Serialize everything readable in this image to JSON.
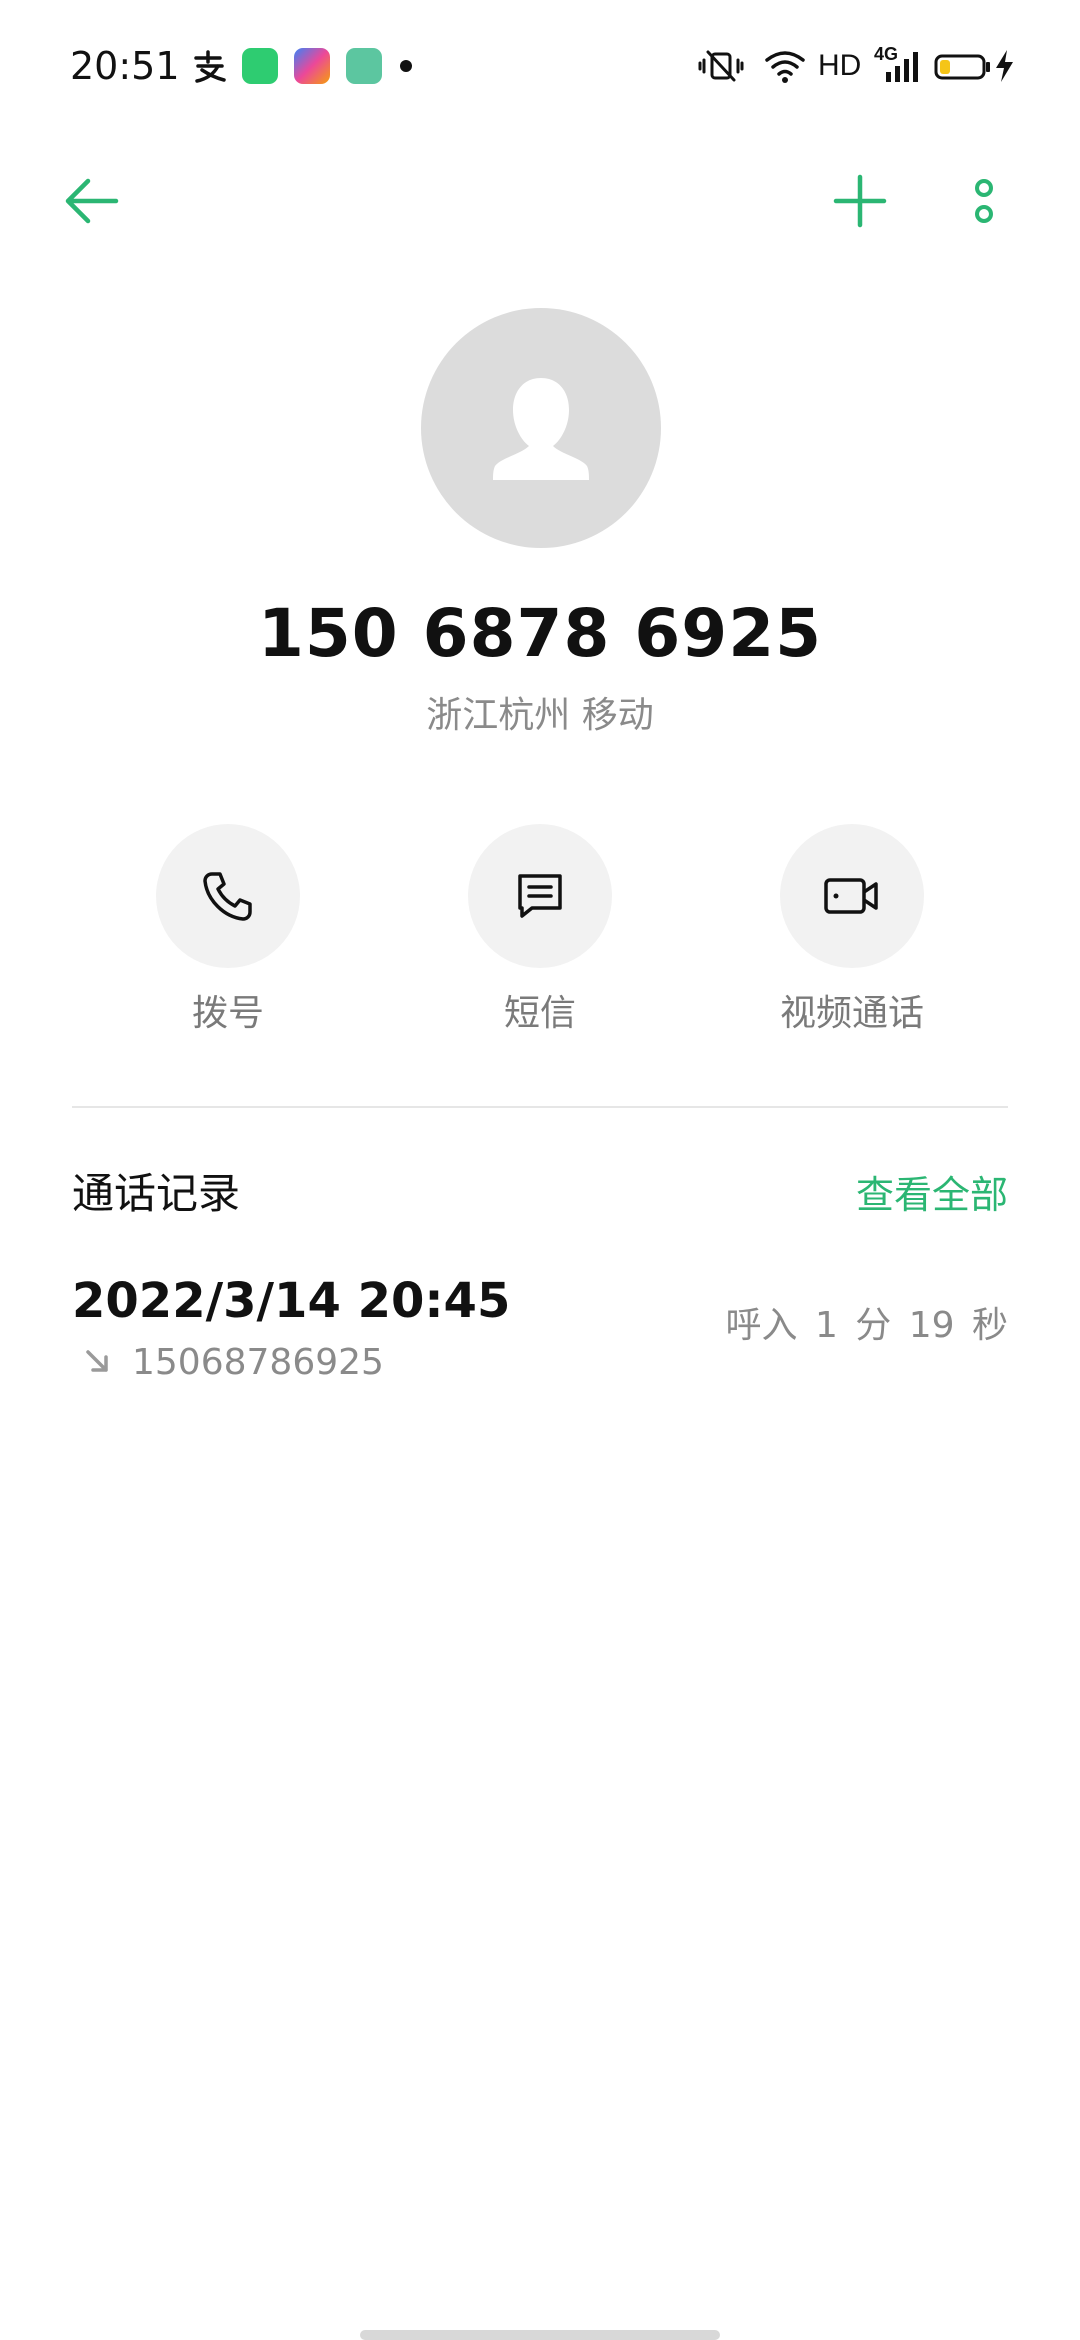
{
  "status_bar": {
    "time": "20:51",
    "network_label": "HD",
    "cellular_label": "4G",
    "icons": [
      "alipay-icon",
      "app-green-icon",
      "app-gradient-icon",
      "app-teal-icon",
      "notification-dot-icon",
      "vibrate-icon",
      "wifi-icon",
      "cellular-signal-icon",
      "battery-icon",
      "charging-icon"
    ]
  },
  "toolbar": {
    "back_icon": "arrow-left-icon",
    "add_icon": "plus-icon",
    "more_icon": "more-vertical-icon"
  },
  "contact": {
    "avatar_icon": "person-icon",
    "number": "150 6878 6925",
    "location": "浙江杭州 移动"
  },
  "actions": [
    {
      "label": "拨号",
      "icon": "phone-icon"
    },
    {
      "label": "短信",
      "icon": "message-icon"
    },
    {
      "label": "视频通话",
      "icon": "video-call-icon"
    }
  ],
  "call_log": {
    "title": "通话记录",
    "view_all": "查看全部",
    "records": [
      {
        "datetime": "2022/3/14 20:45",
        "number": "15068786925",
        "direction_icon": "incoming-arrow-icon",
        "type": "呼入",
        "duration": "1 分 19 秒"
      }
    ]
  },
  "colors": {
    "accent": "#2bb673",
    "text_primary": "#111111",
    "text_secondary": "#8a8a8a",
    "avatar_bg": "#dcdcdc",
    "action_bg": "#f2f2f2"
  }
}
